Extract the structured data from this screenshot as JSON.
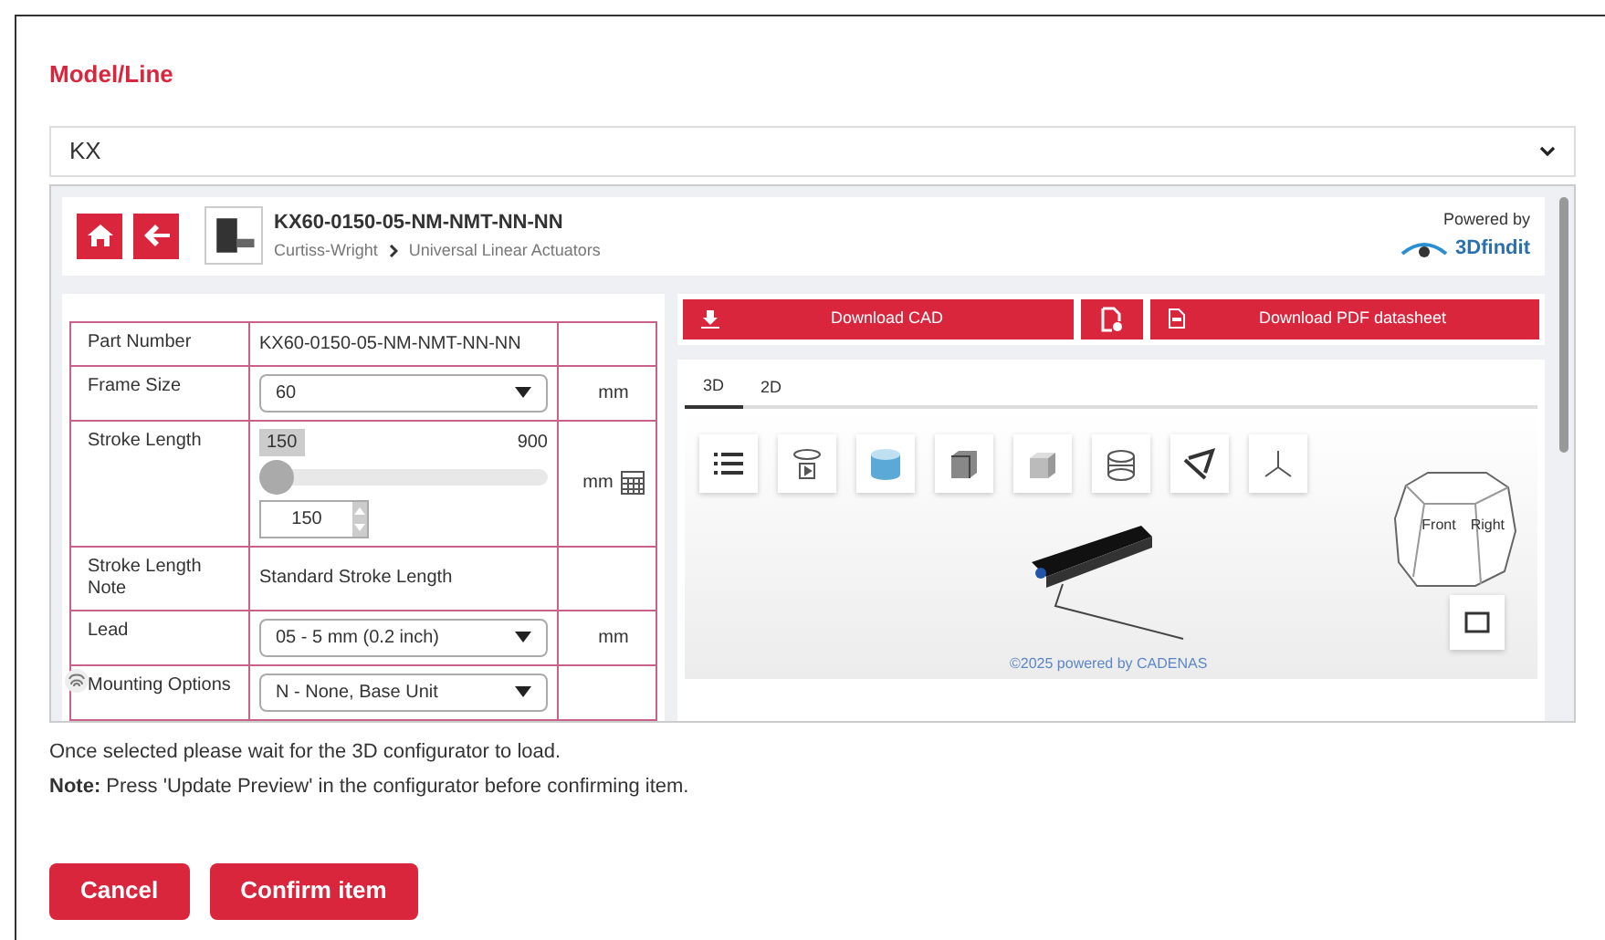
{
  "title": "Model/Line",
  "model_select": {
    "value": "KX"
  },
  "header": {
    "part_number": "KX60-0150-05-NM-NMT-NN-NN",
    "breadcrumb": [
      "Curtiss-Wright",
      "Universal Linear Actuators"
    ],
    "powered_by": "Powered by",
    "brand": "3Dfindit"
  },
  "config_table": {
    "rows": [
      {
        "kind": "text",
        "label": "Part Number",
        "value": "KX60-0150-05-NM-NMT-NN-NN"
      },
      {
        "kind": "select",
        "label": "Frame Size",
        "value": "60",
        "unit": "mm"
      },
      {
        "kind": "slider",
        "label": "Stroke Length",
        "min": "150",
        "max": "900",
        "level": 0,
        "value": "150",
        "unit": "mm"
      },
      {
        "kind": "text",
        "label": "Stroke Length Note",
        "value": "Standard Stroke Length"
      },
      {
        "kind": "select",
        "label": "Lead",
        "value": "05 - 5 mm (0.2 inch)",
        "unit": "mm"
      },
      {
        "kind": "select",
        "label": "Mounting Options",
        "value": "N - None, Base Unit"
      }
    ]
  },
  "actions": [
    {
      "kind": "cad",
      "label": "Download CAD"
    },
    {
      "kind": "settings"
    },
    {
      "kind": "pdf",
      "label": "Download PDF datasheet"
    }
  ],
  "view_tabs": [
    {
      "label": "3D",
      "selected": true
    },
    {
      "label": "2D",
      "selected": false
    }
  ],
  "viewer": {
    "cube_faces": [
      "Front",
      "Right"
    ],
    "credit": "©2025 powered by CADENAS"
  },
  "messages": [
    "Once selected please wait for the 3D configurator to load.",
    "**Note:** Press 'Update Preview' in the configurator before confirming item."
  ],
  "buttons": [
    "Cancel",
    "Confirm item"
  ]
}
